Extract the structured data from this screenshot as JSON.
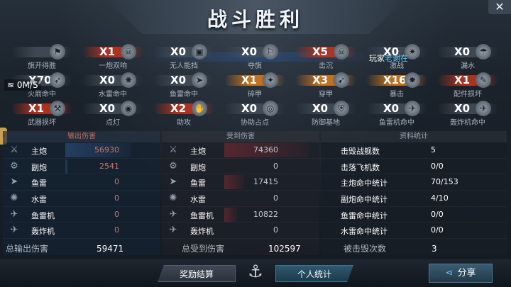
{
  "title": "战斗胜利",
  "close_label": "✕",
  "network": "0M/S",
  "player": {
    "prefix": "玩家",
    "name": "老谢在"
  },
  "awards": [
    {
      "label": "旗开得胜",
      "count": "",
      "style": "gray",
      "icon": "flag-icon"
    },
    {
      "label": "一炮双响",
      "count": "X1",
      "style": "red",
      "icon": "skull-icon"
    },
    {
      "label": "无人能挡",
      "count": "X0",
      "style": "gray",
      "icon": "tank-icon"
    },
    {
      "label": "夺旗",
      "count": "X0",
      "style": "gray",
      "icon": "flag-capture-icon"
    },
    {
      "label": "击沉",
      "count": "X5",
      "style": "red",
      "icon": "skull-icon"
    },
    {
      "label": "激战",
      "count": "X0",
      "style": "gray",
      "icon": "battle-icon"
    },
    {
      "label": "漏水",
      "count": "X0",
      "style": "gray",
      "icon": "leak-icon"
    },
    {
      "label": "火箭命中",
      "count": "X70",
      "style": "gray",
      "icon": "rocket-icon"
    },
    {
      "label": "水雷命中",
      "count": "X0",
      "style": "gray",
      "icon": "mine-icon"
    },
    {
      "label": "鱼雷命中",
      "count": "X0",
      "style": "gray",
      "icon": "torpedo-icon"
    },
    {
      "label": "碎甲",
      "count": "X1",
      "style": "orange",
      "icon": "shatter-icon"
    },
    {
      "label": "穿甲",
      "count": "X3",
      "style": "orange",
      "icon": "pierce-icon"
    },
    {
      "label": "暴击",
      "count": "X16",
      "style": "orange",
      "icon": "crit-icon"
    },
    {
      "label": "配件损坏",
      "count": "X1",
      "style": "red",
      "icon": "wrench-icon"
    },
    {
      "label": "武器损坏",
      "count": "X1",
      "style": "red",
      "icon": "gun-icon"
    },
    {
      "label": "点灯",
      "count": "X0",
      "style": "gray",
      "icon": "eye-icon"
    },
    {
      "label": "助攻",
      "count": "X2",
      "style": "red",
      "icon": "hand-icon"
    },
    {
      "label": "协助占点",
      "count": "X0",
      "style": "gray",
      "icon": "target-icon"
    },
    {
      "label": "防御基地",
      "count": "X0",
      "style": "gray",
      "icon": "shield-icon"
    },
    {
      "label": "鱼雷机命中",
      "count": "X0",
      "style": "gray",
      "icon": "torpedo-plane-icon"
    },
    {
      "label": "轰炸机命中",
      "count": "X0",
      "style": "gray",
      "icon": "bomber-icon"
    }
  ],
  "output": {
    "header": "输出伤害",
    "rows": [
      {
        "name": "主炮",
        "value": "56930",
        "icon": "main-gun-icon",
        "fill": 0.766
      },
      {
        "name": "副炮",
        "value": "2541",
        "icon": "secondary-gun-icon",
        "fill": 0.034
      },
      {
        "name": "鱼雷",
        "value": "0",
        "icon": "torpedo-icon",
        "fill": 0
      },
      {
        "name": "水雷",
        "value": "0",
        "icon": "mine-icon",
        "fill": 0
      },
      {
        "name": "鱼雷机",
        "value": "0",
        "icon": "torpedo-plane-icon",
        "fill": 0
      },
      {
        "name": "轰炸机",
        "value": "0",
        "icon": "bomber-icon",
        "fill": 0
      }
    ],
    "total_label": "总输出伤害",
    "total_value": "59471"
  },
  "received": {
    "header": "受到伤害",
    "rows": [
      {
        "name": "主炮",
        "value": "74360",
        "icon": "main-gun-icon",
        "fill": 1.0
      },
      {
        "name": "副炮",
        "value": "0",
        "icon": "secondary-gun-icon",
        "fill": 0
      },
      {
        "name": "鱼雷",
        "value": "17415",
        "icon": "torpedo-icon",
        "fill": 0.234
      },
      {
        "name": "水雷",
        "value": "0",
        "icon": "mine-icon",
        "fill": 0
      },
      {
        "name": "鱼雷机",
        "value": "10822",
        "icon": "torpedo-plane-icon",
        "fill": 0.146
      },
      {
        "name": "轰炸机",
        "value": "0",
        "icon": "bomber-icon",
        "fill": 0
      }
    ],
    "total_label": "总受到伤害",
    "total_value": "102597"
  },
  "stats": {
    "header": "资料统计",
    "rows": [
      {
        "name": "击毁战舰数",
        "value": "5"
      },
      {
        "name": "击落飞机数",
        "value": "0/0"
      },
      {
        "name": "主炮命中统计",
        "value": "70/153"
      },
      {
        "name": "副炮命中统计",
        "value": "4/10"
      },
      {
        "name": "鱼雷命中统计",
        "value": "0/0"
      },
      {
        "name": "水雷命中统计",
        "value": "0/0"
      }
    ],
    "total_label": "被击毁次数",
    "total_value": "3"
  },
  "buttons": {
    "reward": "奖励结算",
    "personal": "个人统计",
    "share": "分享"
  }
}
